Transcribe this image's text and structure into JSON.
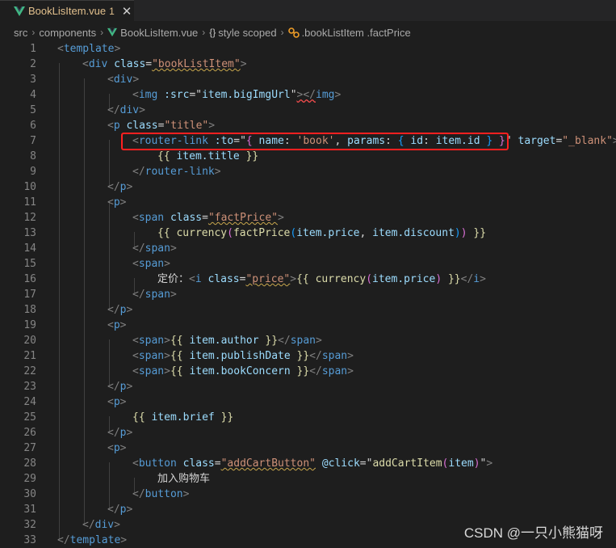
{
  "tab": {
    "name": "BookLisItem.vue",
    "badge": "1",
    "close": "✕"
  },
  "breadcrumb": {
    "items": [
      "src",
      "components",
      "BookLisItem.vue",
      "style scoped",
      ".bookListItem .factPrice"
    ],
    "separator": "›",
    "style_glyph": "{}"
  },
  "line_numbers": [
    "1",
    "2",
    "3",
    "4",
    "5",
    "6",
    "7",
    "8",
    "9",
    "10",
    "11",
    "12",
    "13",
    "14",
    "15",
    "16",
    "17",
    "18",
    "19",
    "20",
    "21",
    "22",
    "23",
    "24",
    "25",
    "26",
    "27",
    "28",
    "29",
    "30",
    "31",
    "32",
    "33"
  ],
  "code": {
    "l1": {
      "open": "<",
      "tag": "template",
      "close": ">"
    },
    "l2": {
      "open": "<",
      "tag": "div",
      "attr": "class",
      "eq": "=",
      "val": "\"bookListItem\"",
      "close": ">"
    },
    "l3": {
      "open": "<",
      "tag": "div",
      "close": ">"
    },
    "l4": {
      "open": "<",
      "tag": "img",
      "attr": ":src",
      "eq": "=",
      "q1": "\"",
      "expr": "item.bigImgUrl",
      "q2": "\"",
      "end_open": "></",
      "end_tag": "img",
      "close": ">"
    },
    "l5": {
      "open": "</",
      "tag": "div",
      "close": ">"
    },
    "l6": {
      "open": "<",
      "tag": "p",
      "attr": "class",
      "eq": "=",
      "val": "\"title\"",
      "close": ">"
    },
    "l7": {
      "open": "<",
      "tag": "router-link",
      "attr": ":to",
      "eq": "=",
      "q1": "\"",
      "b1": "{",
      "k1": "name",
      "c1": ":",
      "s1": "'book'",
      "comma": ",",
      "k2": "params",
      "c2": ":",
      "b2": "{",
      "k3": "id",
      "c3": ":",
      "v3": "item.id",
      "b3": "}",
      "b4": "}",
      "q2": "\"",
      "attr2": "target",
      "eq2": "=",
      "val2": "\"_blank\"",
      "close": ">"
    },
    "l8": {
      "m1": "{{",
      "expr": "item.title",
      "m2": "}}"
    },
    "l9": {
      "open": "</",
      "tag": "router-link",
      "close": ">"
    },
    "l10": {
      "open": "</",
      "tag": "p",
      "close": ">"
    },
    "l11": {
      "open": "<",
      "tag": "p",
      "close": ">"
    },
    "l12": {
      "open": "<",
      "tag": "span",
      "attr": "class",
      "eq": "=",
      "val": "\"factPrice\"",
      "close": ">"
    },
    "l13": {
      "m1": "{{",
      "f1": "currency",
      "p1": "(",
      "f2": "factPrice",
      "p2": "(",
      "a1": "item.price",
      "comma": ",",
      "a2": "item.discount",
      "p3": ")",
      "p4": ")",
      "m2": "}}"
    },
    "l14": {
      "open": "</",
      "tag": "span",
      "close": ">"
    },
    "l15": {
      "open": "<",
      "tag": "span",
      "close": ">"
    },
    "l16": {
      "label": "定价：",
      "open": "<",
      "tag": "i",
      "attr": "class",
      "eq": "=",
      "val": "\"price\"",
      "close": ">",
      "m1": "{{",
      "f1": "currency",
      "p1": "(",
      "a1": "item.price",
      "p2": ")",
      "m2": "}}",
      "end_open": "</",
      "end_tag": "i",
      "end_close": ">"
    },
    "l17": {
      "open": "</",
      "tag": "span",
      "close": ">"
    },
    "l18": {
      "open": "</",
      "tag": "p",
      "close": ">"
    },
    "l19": {
      "open": "<",
      "tag": "p",
      "close": ">"
    },
    "l20": {
      "open": "<",
      "tag": "span",
      "close": ">",
      "m1": "{{",
      "expr": "item.author",
      "m2": "}}",
      "end_open": "</",
      "end_tag": "span",
      "end_close": ">"
    },
    "l21": {
      "open": "<",
      "tag": "span",
      "close": ">",
      "m1": "{{",
      "expr": "item.publishDate",
      "m2": "}}",
      "end_open": "</",
      "end_tag": "span",
      "end_close": ">"
    },
    "l22": {
      "open": "<",
      "tag": "span",
      "close": ">",
      "m1": "{{",
      "expr": "item.bookConcern",
      "m2": "}}",
      "end_open": "</",
      "end_tag": "span",
      "end_close": ">"
    },
    "l23": {
      "open": "</",
      "tag": "p",
      "close": ">"
    },
    "l24": {
      "open": "<",
      "tag": "p",
      "close": ">"
    },
    "l25": {
      "m1": "{{",
      "expr": "item.brief",
      "m2": "}}"
    },
    "l26": {
      "open": "</",
      "tag": "p",
      "close": ">"
    },
    "l27": {
      "open": "<",
      "tag": "p",
      "close": ">"
    },
    "l28": {
      "open": "<",
      "tag": "button",
      "attr": "class",
      "eq": "=",
      "val": "\"addCartButton\"",
      "attr2": "@click",
      "eq2": "=",
      "q1": "\"",
      "f1": "addCartItem",
      "p1": "(",
      "a1": "item",
      "p2": ")",
      "q2": "\"",
      "close": ">"
    },
    "l29": {
      "text": "加入购物车"
    },
    "l30": {
      "open": "</",
      "tag": "button",
      "close": ">"
    },
    "l31": {
      "open": "</",
      "tag": "p",
      "close": ">"
    },
    "l32": {
      "open": "</",
      "tag": "div",
      "close": ">"
    },
    "l33": {
      "open": "</",
      "tag": "template",
      "close": ">"
    }
  },
  "watermark": "CSDN @一只小熊猫呀",
  "colors": {
    "background": "#1e1e1e",
    "tag": "#569cd6",
    "attribute": "#9cdcfe",
    "string": "#ce9178",
    "function": "#dcdcaa",
    "modified_file": "#e2c08d",
    "highlight_box": "#ff2020"
  }
}
